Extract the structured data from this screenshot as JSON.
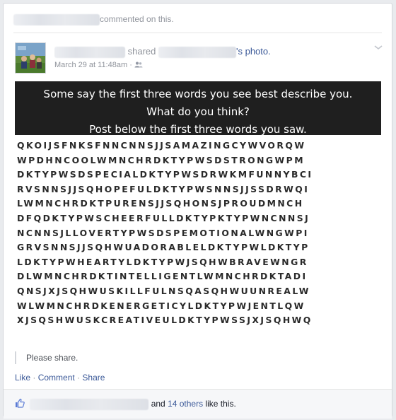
{
  "activity": {
    "suffix": "commented on this."
  },
  "post": {
    "shared_word": "shared",
    "photo_link": "'s photo.",
    "timestamp": "March 29 at 11:48am",
    "meta_separator": "·"
  },
  "puzzle": {
    "heading": [
      "Some say the first three words you see best describe you.",
      "What do you think?",
      "Post below the first three words you saw."
    ],
    "rows": [
      "QKOIJSFNKSFNNCNNSJJSAMAZINGCYWVORQW",
      "WPDHNCOOLWMNCHRDKTYPWSDSTRONGWPM",
      "DKTYPWSDSPECIALDKTYPWSDRWKMFUNNYBCI",
      "RVSNNSJJSQHOPEFULDKTYPWSNNSJJSSDRWQI",
      "LWMNCHRDKTPURENSJJSQHONSJPROUDMNCH",
      "DFQDKTYPWSCHEERFULLDKTYPKTYPWNCNNSJ",
      "NCNNSJLLOVERTYPWSDSPEMOTIONALWNGWPI",
      "GRVSNNSJJSQHWUADORABLELDKTYPWLDKTYP",
      "LDKTYPWHEARTYLDKTYPWJSQHWBRAVEWNGR",
      "DLWMNCHRDKTINTELLIGENTLWMNCHRDKTADI",
      "QNSJXJSQHWUSKILLFULNSQASQHWUUNREALW",
      "WLWMNCHRDKENERGETICYLDKTYPWJENTLQW",
      "XJSQSHWUSKCREATIVEULDKTYPWSSJXJSQHWQ"
    ]
  },
  "caption": "Please share.",
  "actions": {
    "like": "Like",
    "comment": "Comment",
    "share": "Share",
    "separator": "·"
  },
  "likes": {
    "middle": "and",
    "others": "14 others",
    "suffix": "like this."
  },
  "colors": {
    "link": "#3b5998",
    "meta": "#90949c",
    "dark_banner": "#1f1f1f"
  },
  "icons": [
    "avatar-photo",
    "friends-audience-icon",
    "chevron-down-icon",
    "thumbs-up-icon"
  ]
}
